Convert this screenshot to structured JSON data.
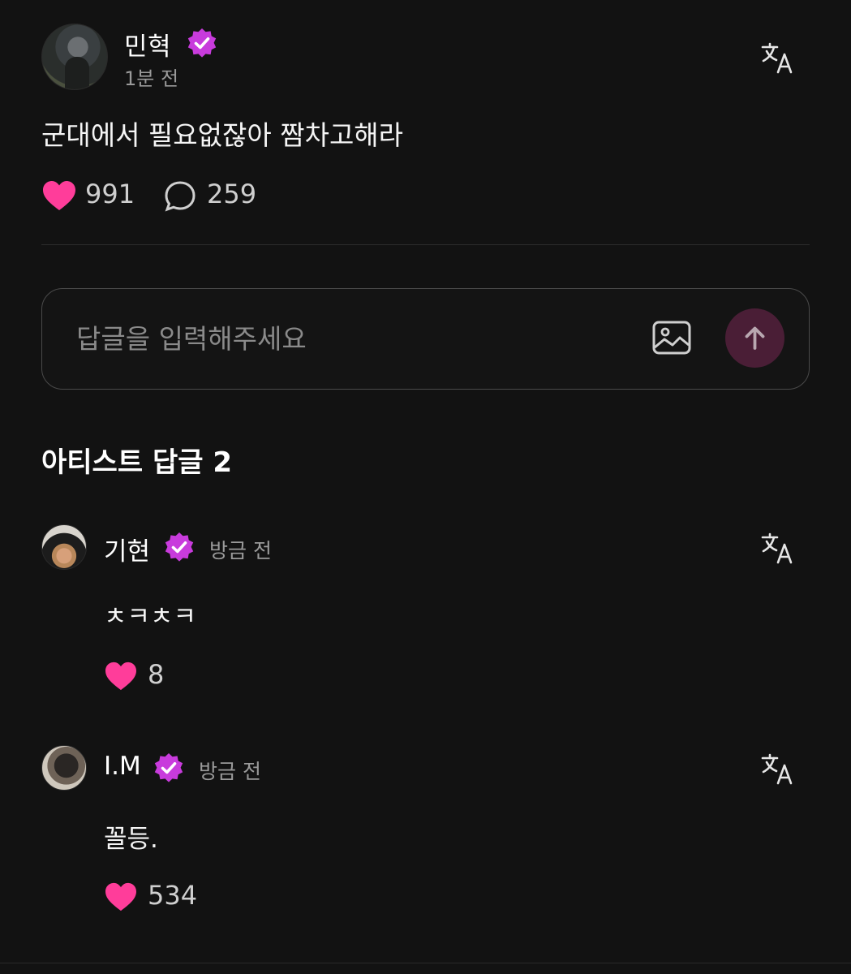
{
  "post": {
    "author": "민혁",
    "time": "1분 전",
    "text": "군대에서 필요없잖아 짬차고해라",
    "likes": "991",
    "comments": "259"
  },
  "reply_input": {
    "placeholder": "답글을 입력해주세요"
  },
  "artist_replies": {
    "title": "아티스트 답글 2",
    "items": [
      {
        "author": "기현",
        "time": "방금 전",
        "text": "ㅊㅋㅊㅋ",
        "likes": "8"
      },
      {
        "author": "I.M",
        "time": "방금 전",
        "text": "꼴등.",
        "likes": "534"
      }
    ]
  },
  "icons": {
    "verified": "verified-badge-icon",
    "translate": "translate-icon",
    "heart": "heart-icon",
    "comment": "comment-icon",
    "image": "image-icon",
    "send": "arrow-up-icon"
  },
  "colors": {
    "background": "#121212",
    "heart": "#ff3d9a",
    "verified": "#c83bdc",
    "send_button": "#4a1e36"
  }
}
